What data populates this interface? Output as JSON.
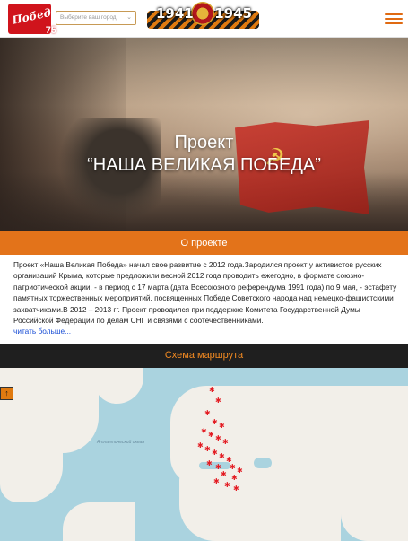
{
  "header": {
    "logo_text": "Победа!",
    "logo_number": "75",
    "city_placeholder": "Выберите ваш город",
    "year_start": "1941",
    "year_end": "1945"
  },
  "hero": {
    "title_line1": "Проект",
    "title_line2": "“НАША ВЕЛИКАЯ ПОБЕДА”"
  },
  "about": {
    "heading": "О проекте",
    "text": "Проект «Наша Великая Победа» начал свое развитие с 2012 года.Зародился проект у активистов русских организаций Крыма, которые предложили весной 2012 года проводить ежегодно, в формате союзно-патриотической акции, - в период с 17 марта (дата Всесоюзного референдума 1991 года) по 9 мая, - эстафету памятных торжественных мероприятий, посвященных Победе Советского народа над немецко-фашистскими захватчиками.В 2012 – 2013 гг. Проект проводился при поддержке Комитета Государственной Думы Российской Федерации по делам СНГ и связями с соотечественниками.",
    "more_link": "читать больше..."
  },
  "route": {
    "heading": "Схема маршрута"
  },
  "map": {
    "ocean_labels": [
      "Атлантический океан"
    ],
    "icons": {
      "map_button": "arrow-up-icon",
      "marker": "star-marker-icon"
    },
    "colors": {
      "water": "#aad3df",
      "land": "#f2efe9",
      "marker": "#e31c23"
    }
  },
  "theme": {
    "accent": "#e3731a",
    "dark_bar": "#1f1f1f",
    "link": "#1a4fd6"
  }
}
